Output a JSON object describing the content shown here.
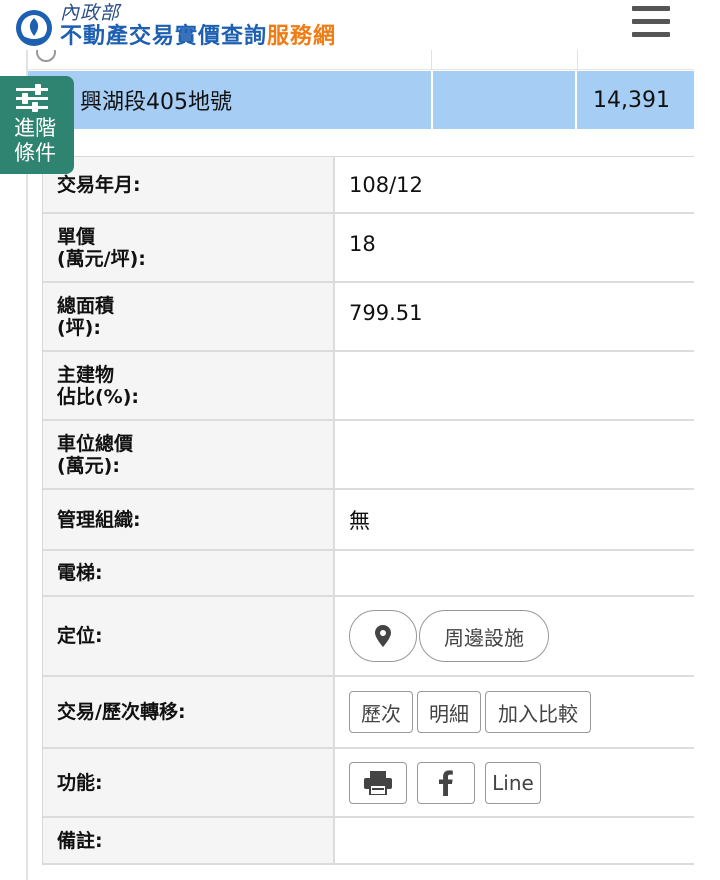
{
  "header": {
    "ministry": "內政部",
    "title_main": "不動產交易實價查詢",
    "title_accent": "服務網"
  },
  "selected_record": {
    "name": "興湖段405地號",
    "value": "14,391"
  },
  "advanced_filter": {
    "line1": "進階",
    "line2": "條件"
  },
  "details": {
    "trade_date": {
      "label": "交易年月:",
      "value": "108/12"
    },
    "unit_price": {
      "label_l1": "單價",
      "label_l2": "(萬元/坪):",
      "value": "18"
    },
    "total_area": {
      "label_l1": "總面積",
      "label_l2": "(坪):",
      "value": "799.51"
    },
    "main_building_ratio": {
      "label_l1": "主建物",
      "label_l2": "佔比(%):",
      "value": ""
    },
    "parking_total": {
      "label_l1": "車位總價",
      "label_l2": "(萬元):",
      "value": ""
    },
    "management": {
      "label": "管理組織:",
      "value": "無"
    },
    "elevator": {
      "label": "電梯:",
      "value": ""
    },
    "location": {
      "label": "定位:",
      "nearby_button": "周邊設施"
    },
    "transfer": {
      "label": "交易/歷次轉移:",
      "history_button": "歷次",
      "detail_button": "明細",
      "compare_button": "加入比較"
    },
    "functions": {
      "label": "功能:",
      "line_button": "Line"
    },
    "remarks": {
      "label": "備註:",
      "value": ""
    }
  },
  "colors": {
    "title_blue": "#1d5fb0",
    "title_orange": "#ef7d14",
    "selected_row": "#a6cdf3",
    "filter_green": "#2e8470"
  }
}
